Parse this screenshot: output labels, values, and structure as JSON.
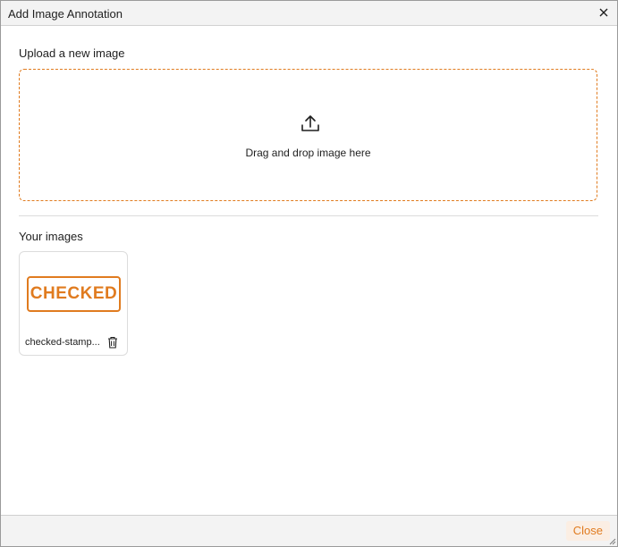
{
  "dialog": {
    "title": "Add Image Annotation",
    "close_icon": "close-icon"
  },
  "upload": {
    "heading": "Upload a new image",
    "icon": "upload-icon",
    "drop_text": "Drag and drop image here"
  },
  "images": {
    "heading": "Your images",
    "items": [
      {
        "stamp_text": "CHECKED",
        "file_name": "checked-stamp...",
        "delete_icon": "trash-icon"
      }
    ]
  },
  "footer": {
    "close_label": "Close"
  },
  "colors": {
    "accent": "#e07b1f",
    "accent_bg": "#fbeee3",
    "title_bar_bg": "#f3f3f3"
  }
}
